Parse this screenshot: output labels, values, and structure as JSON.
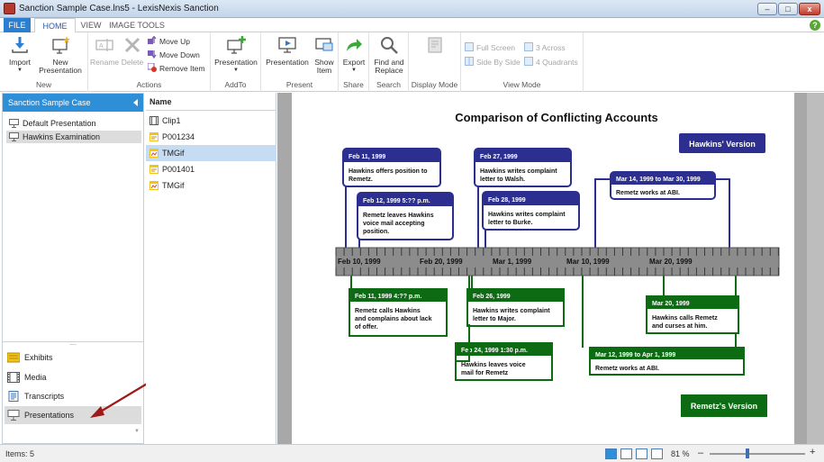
{
  "window": {
    "title": "Sanction Sample Case.lns5 - LexisNexis Sanction",
    "controls": {
      "minimize": "–",
      "maximize": "□",
      "close": "x"
    }
  },
  "ribbon_tabs": [
    {
      "label": "FILE"
    },
    {
      "label": "HOME"
    },
    {
      "label": "VIEW"
    },
    {
      "label": "IMAGE TOOLS"
    }
  ],
  "help_label": "?",
  "ribbon": {
    "new": {
      "group_label": "New",
      "import_label": "Import",
      "new_presentation_label_1": "New",
      "new_presentation_label_2": "Presentation"
    },
    "actions": {
      "group_label": "Actions",
      "rename_label": "Rename",
      "delete_label": "Delete",
      "move_up_label": "Move Up",
      "move_down_label": "Move Down",
      "remove_item_label": "Remove Item"
    },
    "addto": {
      "group_label": "AddTo",
      "presentation_label": "Presentation"
    },
    "present": {
      "group_label": "Present",
      "presentation_label": "Presentation",
      "show_item_label_1": "Show",
      "show_item_label_2": "Item"
    },
    "share": {
      "group_label": "Share",
      "export_label": "Export"
    },
    "search": {
      "group_label": "Search",
      "find_replace_label_1": "Find and",
      "find_replace_label_2": "Replace"
    },
    "display_mode": {
      "group_label": "Display Mode"
    },
    "view_mode": {
      "group_label": "View Mode",
      "full_screen_label": "Full Screen",
      "side_by_side_label": "Side By Side",
      "three_across_label": "3 Across",
      "four_quadrants_label": "4 Quadrants"
    }
  },
  "left_panel": {
    "case_title": "Sanction Sample Case",
    "presentations": [
      {
        "label": "Default Presentation",
        "selected": false
      },
      {
        "label": "Hawkins Examination",
        "selected": true
      }
    ],
    "splitter": "....",
    "nav": [
      {
        "label": "Exhibits",
        "icon": "exhibits-icon",
        "selected": false
      },
      {
        "label": "Media",
        "icon": "media-icon",
        "selected": false
      },
      {
        "label": "Transcripts",
        "icon": "transcripts-icon",
        "selected": false
      },
      {
        "label": "Presentations",
        "icon": "presentation-icon",
        "selected": true
      }
    ]
  },
  "file_list": {
    "column_header": "Name",
    "items": [
      {
        "name": "Clip1",
        "icon": "clip-icon",
        "selected": false
      },
      {
        "name": "P001234",
        "icon": "document-icon",
        "selected": false
      },
      {
        "name": "TMGif",
        "icon": "image-icon",
        "selected": true
      },
      {
        "name": "P001401",
        "icon": "document-icon",
        "selected": false
      },
      {
        "name": "TMGif",
        "icon": "image-icon",
        "selected": false
      }
    ]
  },
  "timeline": {
    "title": "Comparison of Conflicting Accounts",
    "hawkins_version_label": "Hawkins' Version",
    "remetz_version_label": "Remetz's Version",
    "axis_labels": [
      "Feb 10, 1999",
      "Feb 20, 1999",
      "Mar 1, 1999",
      "Mar 10, 1999",
      "Mar 20, 1999"
    ],
    "hawkins_events": [
      {
        "date": "Feb 11, 1999",
        "lines": [
          "Hawkins offers position to",
          "Remetz."
        ]
      },
      {
        "date": "Feb 12, 1999 5:?? p.m.",
        "lines": [
          "Remetz leaves Hawkins",
          "voice mail accepting",
          "position."
        ]
      },
      {
        "date": "Feb 27, 1999",
        "lines": [
          "Hawkins writes complaint",
          "letter to Walsh."
        ]
      },
      {
        "date": "Feb 28, 1999",
        "lines": [
          "Hawkins writes complaint",
          "letter to Burke."
        ]
      },
      {
        "date": "Mar 14, 1999 to Mar 30, 1999",
        "lines": [
          "Remetz works at ABI."
        ]
      }
    ],
    "remetz_events": [
      {
        "date": "Feb 11, 1999 4:?? p.m.",
        "lines": [
          "Remetz calls Hawkins",
          "and complains about lack",
          "of offer."
        ]
      },
      {
        "date": "Feb 26, 1999",
        "lines": [
          "Hawkins writes complaint",
          "letter to Major."
        ]
      },
      {
        "date": "Feb 24, 1999 1:30 p.m.",
        "lines": [
          "Hawkins leaves voice",
          "mail for Remetz"
        ]
      },
      {
        "date": "Mar 20, 1999",
        "lines": [
          "Hawkins calls Remetz",
          "and curses at him."
        ]
      },
      {
        "date": "Mar 12, 1999 to Apr 1, 1999",
        "lines": [
          "Remetz works at ABI."
        ]
      }
    ]
  },
  "status": {
    "items_count": "Items: 5",
    "zoom": "81 %",
    "zoom_minus": "–",
    "zoom_plus": "+",
    "zoom_fraction": 0.4
  },
  "colors": {
    "accent_blue": "#2e8fd9",
    "hawkins_card": "#2c2f8f",
    "remetz_card": "#0d6b14",
    "timeline_bar": "#8c8c8c"
  }
}
